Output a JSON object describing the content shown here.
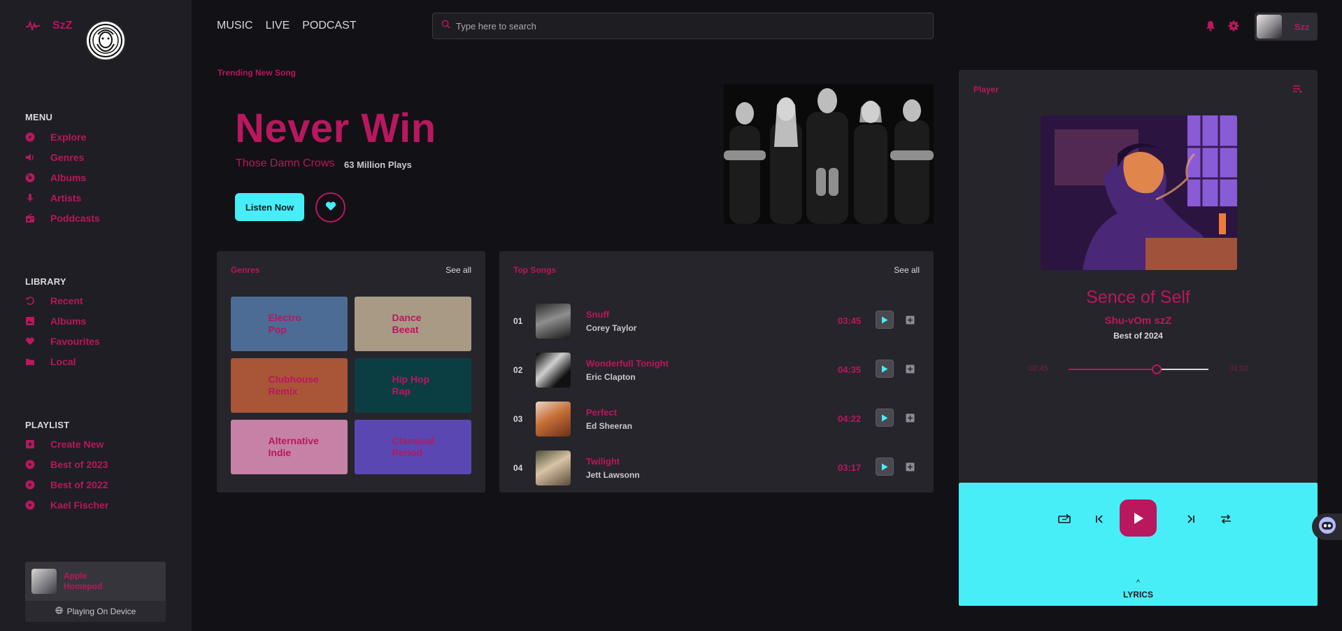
{
  "brand": {
    "name": "SzZ"
  },
  "topnav": {
    "items": [
      "MUSIC",
      "LIVE",
      "PODCAST"
    ]
  },
  "search": {
    "placeholder": "Type here to search"
  },
  "user": {
    "name": "Szz"
  },
  "sidebar": {
    "menu_title": "MENU",
    "menu": [
      {
        "label": "Explore",
        "icon": "compass-icon"
      },
      {
        "label": "Genres",
        "icon": "speaker-icon"
      },
      {
        "label": "Albums",
        "icon": "disc-icon"
      },
      {
        "label": "Artists",
        "icon": "microphone-icon"
      },
      {
        "label": "Poddcasts",
        "icon": "radio-icon"
      }
    ],
    "library_title": "LIBRARY",
    "library": [
      {
        "label": "Recent",
        "icon": "history-icon"
      },
      {
        "label": "Albums",
        "icon": "image-icon"
      },
      {
        "label": "Favourites",
        "icon": "heart-icon"
      },
      {
        "label": "Local",
        "icon": "folder-icon"
      }
    ],
    "playlist_title": "PLAYLIST",
    "playlist": [
      {
        "label": "Create New",
        "icon": "plus-square-icon"
      },
      {
        "label": "Best of 2023",
        "icon": "play-circle-icon"
      },
      {
        "label": "Best of 2022",
        "icon": "play-circle-icon"
      },
      {
        "label": "Kael Fischer",
        "icon": "play-circle-icon"
      }
    ],
    "device": {
      "name": "Apple Homepod",
      "status": "Playing On Device"
    }
  },
  "hero": {
    "label": "Trending New Song",
    "title": "Never Win",
    "artist": "Those Damn Crows",
    "plays": "63 Million Plays",
    "cta": "Listen Now"
  },
  "genres": {
    "title": "Genres",
    "see_all": "See all",
    "items": [
      {
        "label": "Electro\nPop",
        "color": "#4c6b95"
      },
      {
        "label": "Dance\nBeeat",
        "color": "#a99a86"
      },
      {
        "label": "Clubhouse\nRemix",
        "color": "#a85538"
      },
      {
        "label": "Hip Hop\nRap",
        "color": "#0b3e42"
      },
      {
        "label": "Alternative\nIndie",
        "color": "#c582a6"
      },
      {
        "label": "Classical\nPeriod",
        "color": "#5a47b1"
      }
    ]
  },
  "top_songs": {
    "title": "Top Songs",
    "see_all": "See all",
    "items": [
      {
        "num": "01",
        "title": "Snuff",
        "artist": "Corey Taylor",
        "duration": "03:45"
      },
      {
        "num": "02",
        "title": "Wonderfull Tonight",
        "artist": "Eric Clapton",
        "duration": "04:35"
      },
      {
        "num": "03",
        "title": "Perfect",
        "artist": "Ed Sheeran",
        "duration": "04:22"
      },
      {
        "num": "04",
        "title": "Twilight",
        "artist": "Jett Lawsonn",
        "duration": "03:17"
      }
    ]
  },
  "player": {
    "title": "Player",
    "song": "Sence of Self",
    "artist": "Shu-vOm szZ",
    "album": "Best of 2024",
    "elapsed": "02:45",
    "remaining": "01:02",
    "progress": 0.63,
    "lyrics_label": "LYRICS"
  },
  "colors": {
    "accent": "#b9175e",
    "cyan": "#47eef7",
    "bg": "#121116",
    "panel": "#26252b"
  }
}
